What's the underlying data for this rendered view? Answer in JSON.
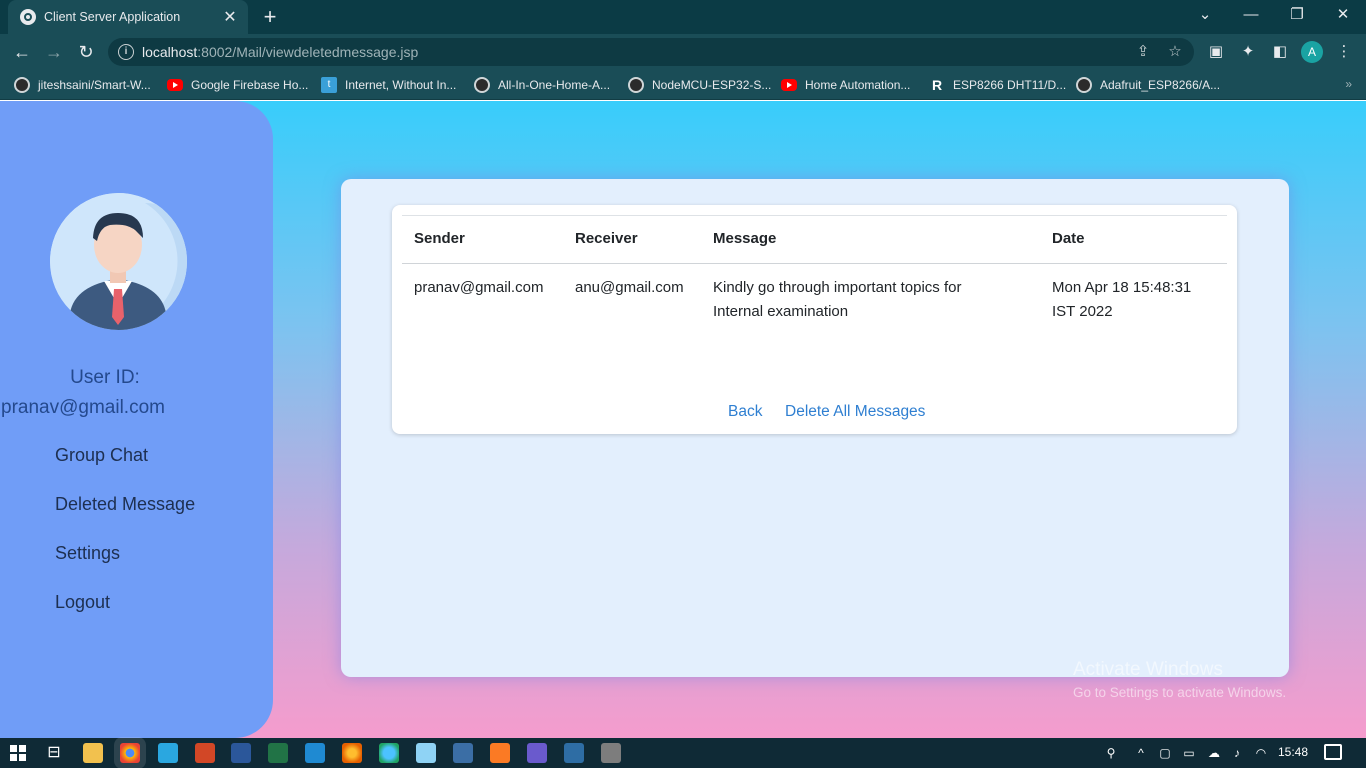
{
  "browser": {
    "tab_title": "Client Server Application",
    "new_tab": "+",
    "url_host": "localhost",
    "url_rest": ":8002/Mail/viewdeletedmessage.jsp",
    "profile_initial": "A",
    "bookmarks": [
      {
        "label": "jiteshsaini/Smart-W...",
        "icon": "github-icon"
      },
      {
        "label": "Google Firebase Ho...",
        "icon": "youtube-icon"
      },
      {
        "label": "Internet, Without In...",
        "icon": "globe-icon"
      },
      {
        "label": "All-In-One-Home-A...",
        "icon": "github-icon"
      },
      {
        "label": "NodeMCU-ESP32-S...",
        "icon": "github-icon"
      },
      {
        "label": "Home Automation...",
        "icon": "youtube-icon"
      },
      {
        "label": "ESP8266 DHT11/D...",
        "icon": "r-icon"
      },
      {
        "label": "Adafruit_ESP8266/A...",
        "icon": "github-icon"
      }
    ],
    "bookmarks_more": "»"
  },
  "sidebar": {
    "user_label": "User ID:",
    "user_email": "pranav@gmail.com",
    "menu": [
      "Group Chat",
      "Deleted Message",
      "Settings",
      "Logout"
    ]
  },
  "table": {
    "headers": [
      "Sender",
      "Receiver",
      "Message",
      "Date"
    ],
    "rows": [
      {
        "sender": "pranav@gmail.com",
        "receiver": "anu@gmail.com",
        "message": [
          "Kindly go through important topics for",
          "Internal examination"
        ],
        "date": [
          "Mon Apr 18 15:48:31",
          "IST 2022"
        ]
      }
    ]
  },
  "actions": {
    "back": "Back",
    "delete_all": "Delete All Messages"
  },
  "watermark": {
    "line1": "Activate Windows",
    "line2": "Go to Settings to activate Windows."
  },
  "taskbar": {
    "time": "15:48"
  },
  "colors": {
    "link": "#2f7fd1",
    "sidebar": "#709df7",
    "card": "#e3effd"
  }
}
